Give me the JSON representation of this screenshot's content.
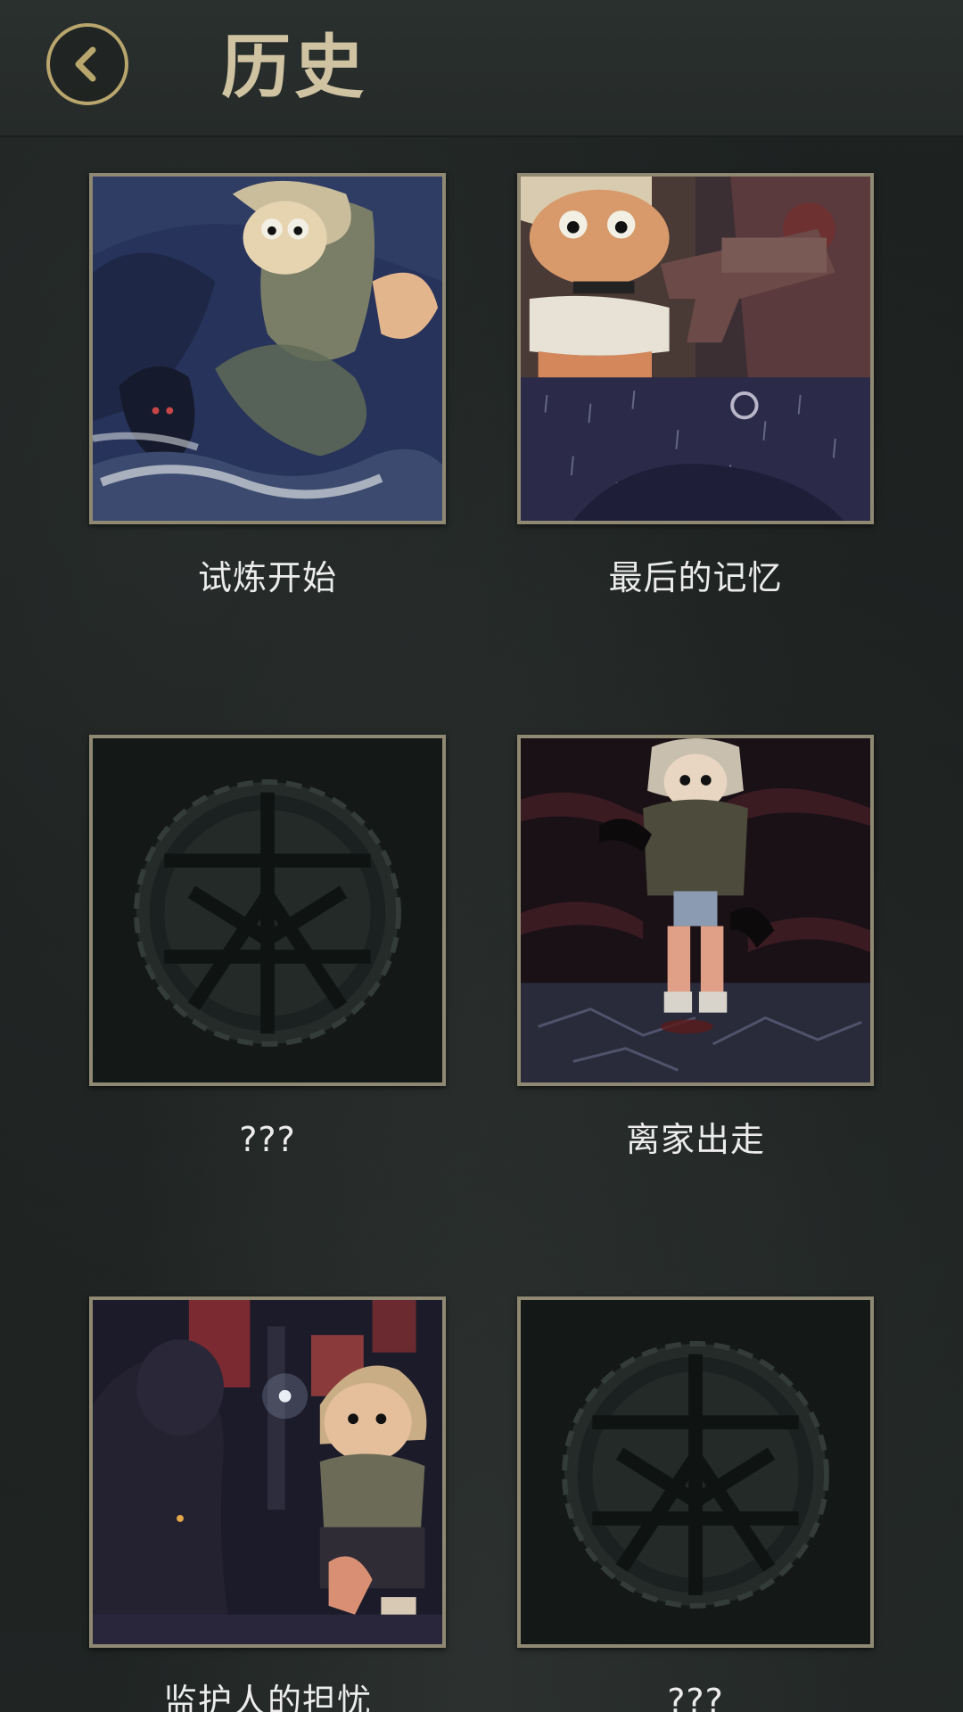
{
  "header": {
    "title": "历史",
    "back_icon": "chevron-left-icon"
  },
  "colors": {
    "accent_gold": "#b9a66d",
    "title_text": "#cfc3a2",
    "label_text": "#ececec",
    "frame": "#8f8873"
  },
  "history": {
    "items": [
      {
        "label": "试炼开始",
        "locked": false
      },
      {
        "label": "最后的记忆",
        "locked": false
      },
      {
        "label": "???",
        "locked": true
      },
      {
        "label": "离家出走",
        "locked": false
      },
      {
        "label": "监护人的担忧",
        "locked": false
      },
      {
        "label": "???",
        "locked": true
      }
    ]
  }
}
